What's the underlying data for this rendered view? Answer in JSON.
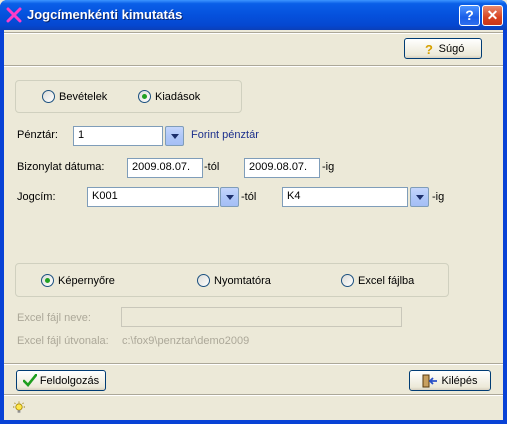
{
  "window": {
    "title": "Jogcímenkénti kimutatás",
    "help_glyph": "?",
    "close_glyph": "✕"
  },
  "toolbar": {
    "help_label": "Súgó"
  },
  "report_type": {
    "options": [
      "Bevételek",
      "Kiadások"
    ],
    "selected": "Kiadások"
  },
  "form": {
    "cashbox_label": "Pénztár:",
    "cashbox_value": "1",
    "cashbox_name": "Forint pénztár",
    "date_label": "Bizonylat dátuma:",
    "date_from": "2009.08.07.",
    "date_from_suffix": "-tól",
    "date_to": "2009.08.07.",
    "date_to_suffix": "-ig",
    "title_label": "Jogcím:",
    "title_from": "K001",
    "title_from_suffix": "-tól",
    "title_to": "K4",
    "title_to_suffix": "-ig"
  },
  "output": {
    "options": [
      "Képernyőre",
      "Nyomtatóra",
      "Excel fájlba"
    ],
    "selected": "Képernyőre"
  },
  "excel": {
    "filename_label": "Excel fájl neve:",
    "filename_value": "",
    "path_label": "Excel fájl útvonala:",
    "path_value": "c:\\fox9\\penztar\\demo2009"
  },
  "actions": {
    "process_label": "Feldolgozás",
    "exit_label": "Kilépés"
  },
  "colors": {
    "accent": "#0551dd",
    "selected_radio": "#21a121",
    "link": "#1b2f8c"
  }
}
